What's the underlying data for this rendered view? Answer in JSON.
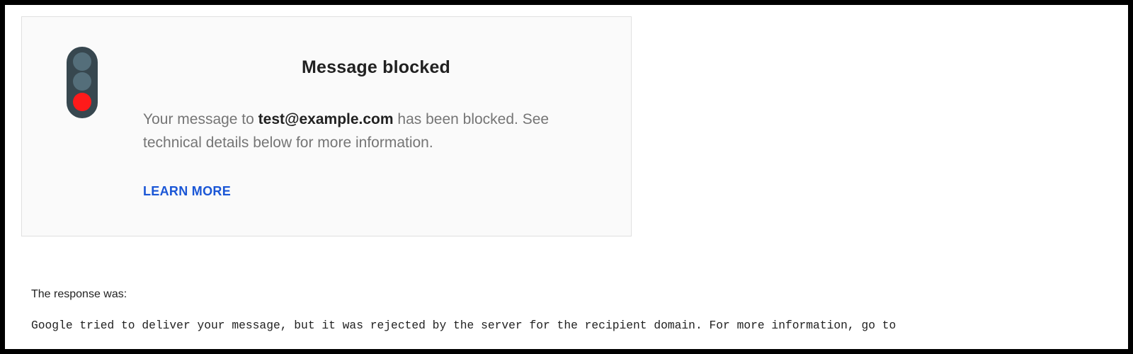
{
  "notice": {
    "icon": "traffic-light-red-icon",
    "title": "Message blocked",
    "body_prefix": "Your message to ",
    "recipient": "test@example.com",
    "body_suffix": " has been blocked. See technical details below for more information.",
    "learn_more_label": "LEARN MORE"
  },
  "details": {
    "response_label": "The response was:",
    "response_text": "Google tried to deliver your message, but it was rejected by the server for the recipient domain. For more information, go to"
  },
  "colors": {
    "card_background": "#fafafa",
    "link": "#1a56d6",
    "red_light": "#ff1a1a",
    "traffic_light_body": "#37474f"
  }
}
